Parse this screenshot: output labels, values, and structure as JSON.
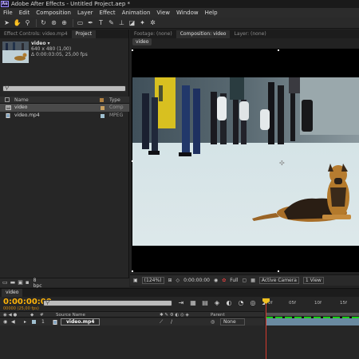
{
  "app": {
    "title": "Adobe After Effects - Untitled Project.aep *",
    "logo": "Ae"
  },
  "menu": [
    "File",
    "Edit",
    "Composition",
    "Layer",
    "Effect",
    "Animation",
    "View",
    "Window",
    "Help"
  ],
  "toolbar": {
    "tools": [
      "selection-tool",
      "hand-tool",
      "zoom-tool",
      "rotate-tool",
      "camera-tool",
      "pan-behind-tool",
      "mask-tool",
      "pen-tool",
      "type-tool",
      "brush-tool",
      "clone-stamp-tool",
      "eraser-tool",
      "roto-brush-tool",
      "puppet-tool"
    ]
  },
  "left_panel": {
    "tabs": [
      "Effect Controls: video.mp4",
      "Project"
    ],
    "project": {
      "selected_name": "video ▾",
      "dimensions": "640 x 480 (1,00)",
      "duration": "Δ 0:00:03:05, 25,00 fps",
      "search_placeholder": "",
      "columns": {
        "name": "Name",
        "type": "Type"
      },
      "items": [
        {
          "name": "video",
          "type": "Comp",
          "icon": "composition-icon",
          "label_color": "#c8a060",
          "selected": true
        },
        {
          "name": "video.mp4",
          "type": "MPEG",
          "icon": "footage-icon",
          "label_color": "#a0c0d0",
          "selected": false
        }
      ],
      "bpc": "8 bpc"
    }
  },
  "comp_panel": {
    "tabs": [
      "Footage: (none)",
      "Composition: video",
      "Layer: (none)"
    ],
    "subtab": "video",
    "footer": {
      "zoom": "(124%)",
      "timecode": "0:00:00:00",
      "resolution": "Full",
      "camera": "Active Camera",
      "views": "1 View"
    }
  },
  "timeline": {
    "tab": "video",
    "timecode": "0:00:00:00",
    "fps": "00000 (25,00 fps)",
    "search_placeholder": "",
    "headers": {
      "source_name": "Source Name",
      "parent": "Parent"
    },
    "layer": {
      "number": "1",
      "name": "video.mp4",
      "parent": "None"
    },
    "ruler_ticks": [
      "0f",
      "05f",
      "10f",
      "15f"
    ],
    "colors": {
      "timecode": "#ffb40a",
      "cti": "#d43a2e",
      "layer_bar": "#6a8aa0"
    }
  }
}
